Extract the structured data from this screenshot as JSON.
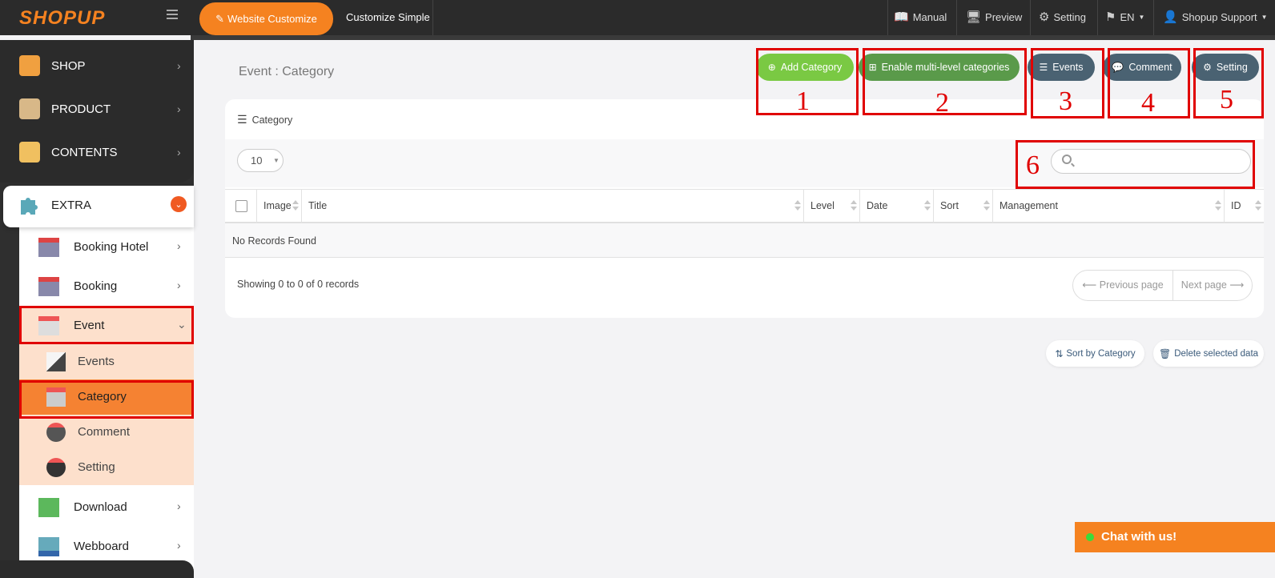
{
  "topbar": {
    "logo": "SHOPUP",
    "customize_label": "Website Customize",
    "customize_simple": "Customize Simple",
    "manual": "Manual",
    "preview": "Preview",
    "setting": "Setting",
    "lang": "EN",
    "support": "Shopup Support"
  },
  "sidebar": {
    "shop": "SHOP",
    "product": "PRODUCT",
    "contents": "CONTENTS",
    "extra": "EXTRA",
    "booking_hotel": "Booking Hotel",
    "booking": "Booking",
    "event": "Event",
    "events": "Events",
    "category": "Category",
    "comment": "Comment",
    "setting": "Setting",
    "download": "Download",
    "webboard": "Webboard"
  },
  "main": {
    "page_title": "Event : Category",
    "buttons": {
      "add_category": "Add Category",
      "multi_level": "Enable multi-level categories",
      "events": "Events",
      "comment": "Comment",
      "setting": "Setting"
    },
    "card_title": "Category",
    "page_size": "10",
    "search_placeholder": "",
    "columns": [
      "Image",
      "Title",
      "Level",
      "Date",
      "Sort",
      "Management",
      "ID"
    ],
    "no_records": "No Records Found",
    "showing": "Showing 0 to 0 of 0 records",
    "prev_page": "⟵ Previous page",
    "next_page": "Next page ⟶",
    "sort_by_category": "Sort by Category",
    "delete_selected": "Delete selected data"
  },
  "annotations": [
    "1",
    "2",
    "3",
    "4",
    "5",
    "6"
  ],
  "chat": {
    "label": "Chat with us!"
  },
  "colors": {
    "brand_orange": "#f58220",
    "add_green": "#7ac943",
    "multi_green": "#5a9a4a",
    "slate": "#4a6272",
    "highlight_red": "#e00000"
  }
}
